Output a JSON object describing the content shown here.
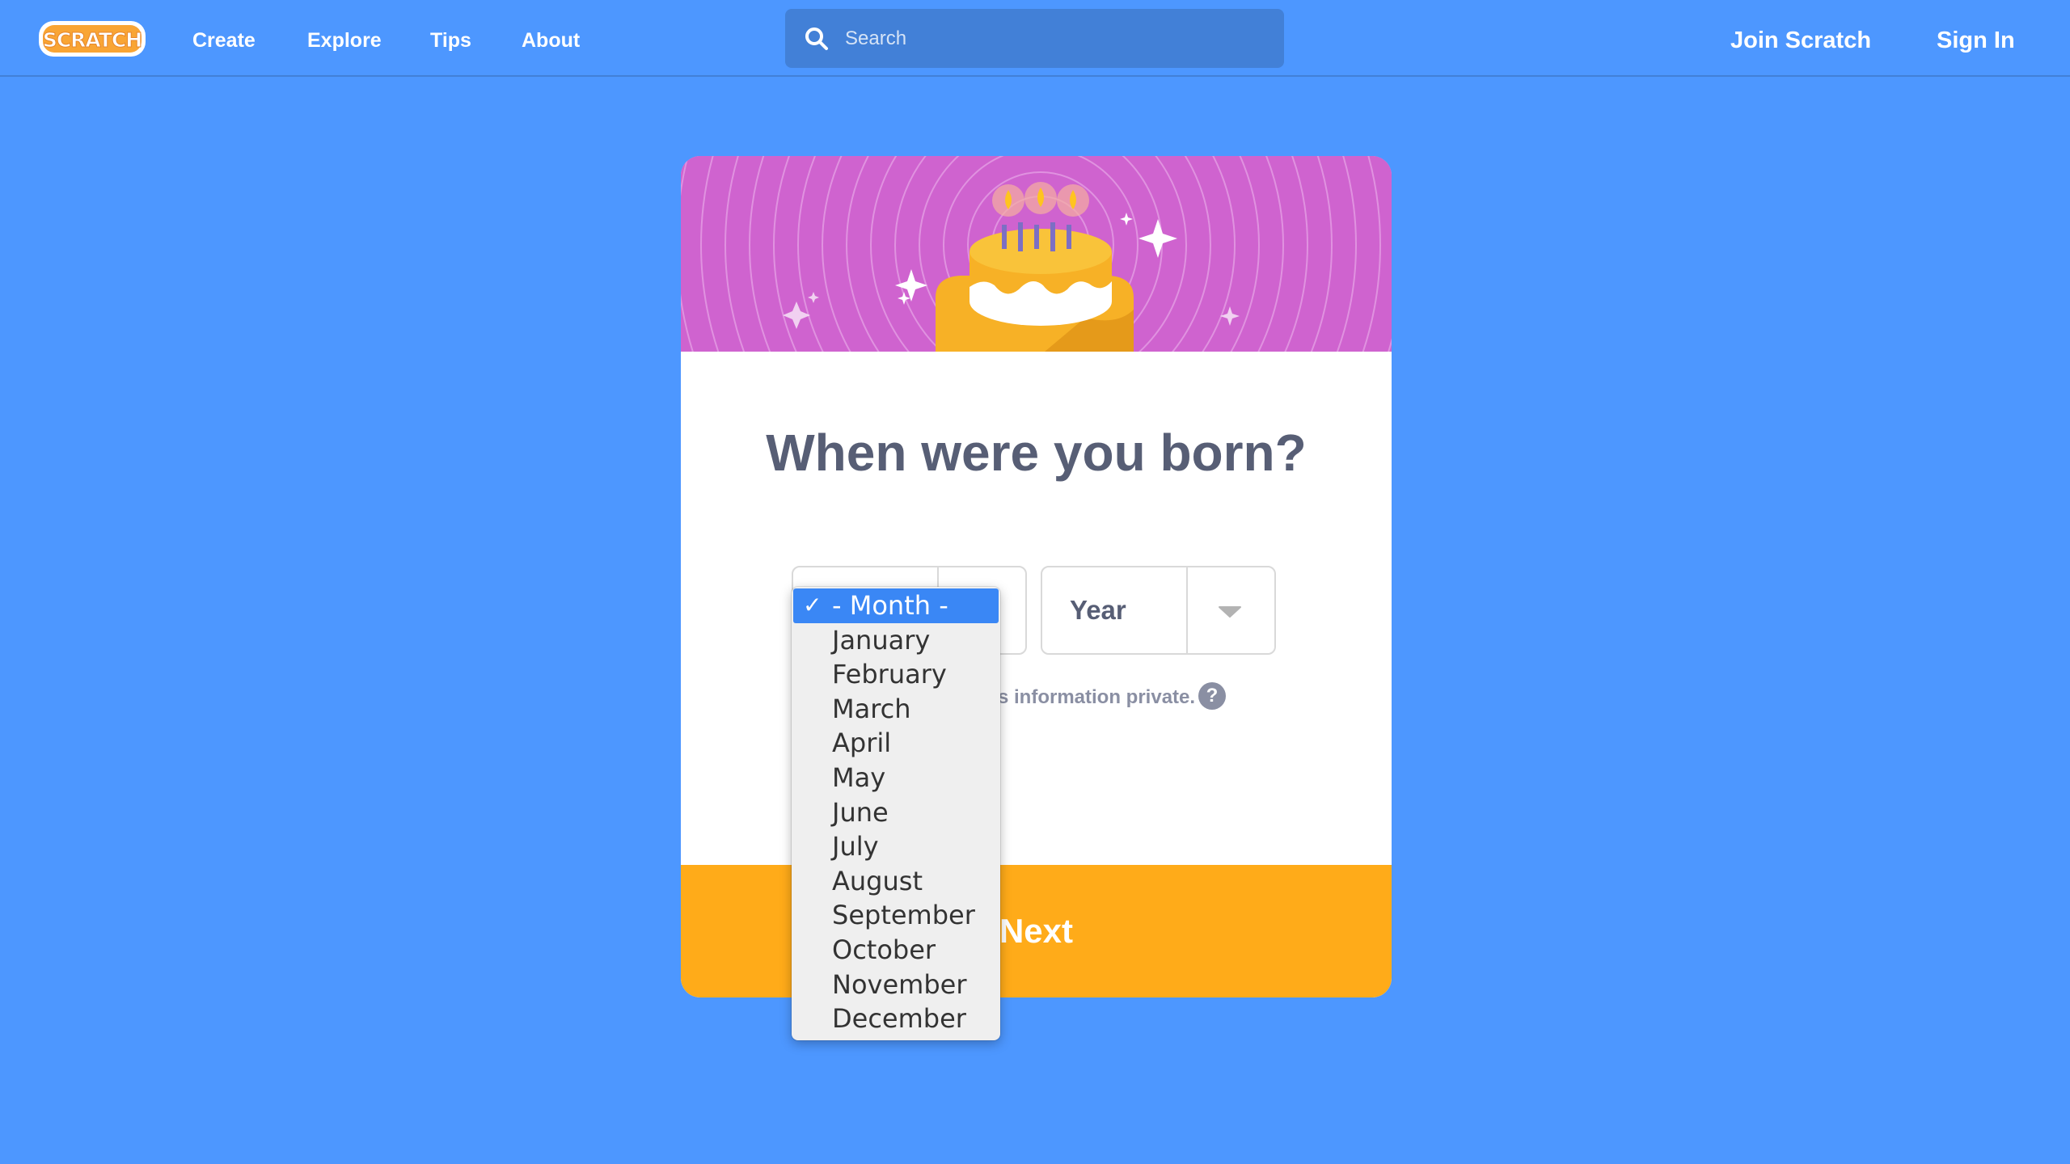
{
  "nav": {
    "logo_text": "SCRATCH",
    "links": [
      "Create",
      "Explore",
      "Tips",
      "About"
    ],
    "search_placeholder": "Search",
    "join": "Join Scratch",
    "sign_in": "Sign In"
  },
  "card": {
    "heading": "When were you born?",
    "year_label": "Year",
    "privacy_note_visible": "s information private.",
    "help_symbol": "?",
    "next_label": "Next"
  },
  "month_dropdown": {
    "checkmark": "✓",
    "options": [
      "- Month -",
      "January",
      "February",
      "March",
      "April",
      "May",
      "June",
      "July",
      "August",
      "September",
      "October",
      "November",
      "December"
    ]
  },
  "colors": {
    "page_bg": "#4d97ff",
    "banner": "#cf63cf",
    "next_button": "#ffab19",
    "dropdown_highlight": "#3a87f5",
    "heading_text": "#575e75"
  }
}
